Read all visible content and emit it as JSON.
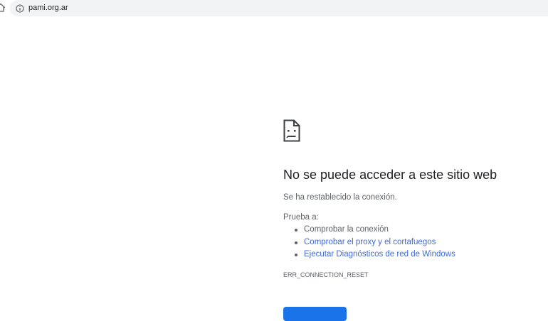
{
  "browser": {
    "url": "pami.org.ar",
    "icons": {
      "home": "home-icon",
      "site_info": "info-icon"
    }
  },
  "error_page": {
    "icon": "sad-document-icon",
    "title": "No se puede acceder a este sitio web",
    "description": "Se ha restablecido la conexión.",
    "try_label": "Prueba a:",
    "suggestions": [
      {
        "label": "Comprobar la conexión",
        "is_link": false
      },
      {
        "label": "Comprobar el proxy y el cortafuegos",
        "is_link": true
      },
      {
        "label": "Ejecutar Diagnósticos de red de Windows",
        "is_link": true
      }
    ],
    "error_code": "ERR_CONNECTION_RESET",
    "reload_label": ""
  },
  "colors": {
    "link": "#4169d6",
    "primary_button": "#1a73e8",
    "omnibox_bg": "#f1f3f4",
    "title_text": "#202124",
    "body_text": "#5f6368"
  }
}
